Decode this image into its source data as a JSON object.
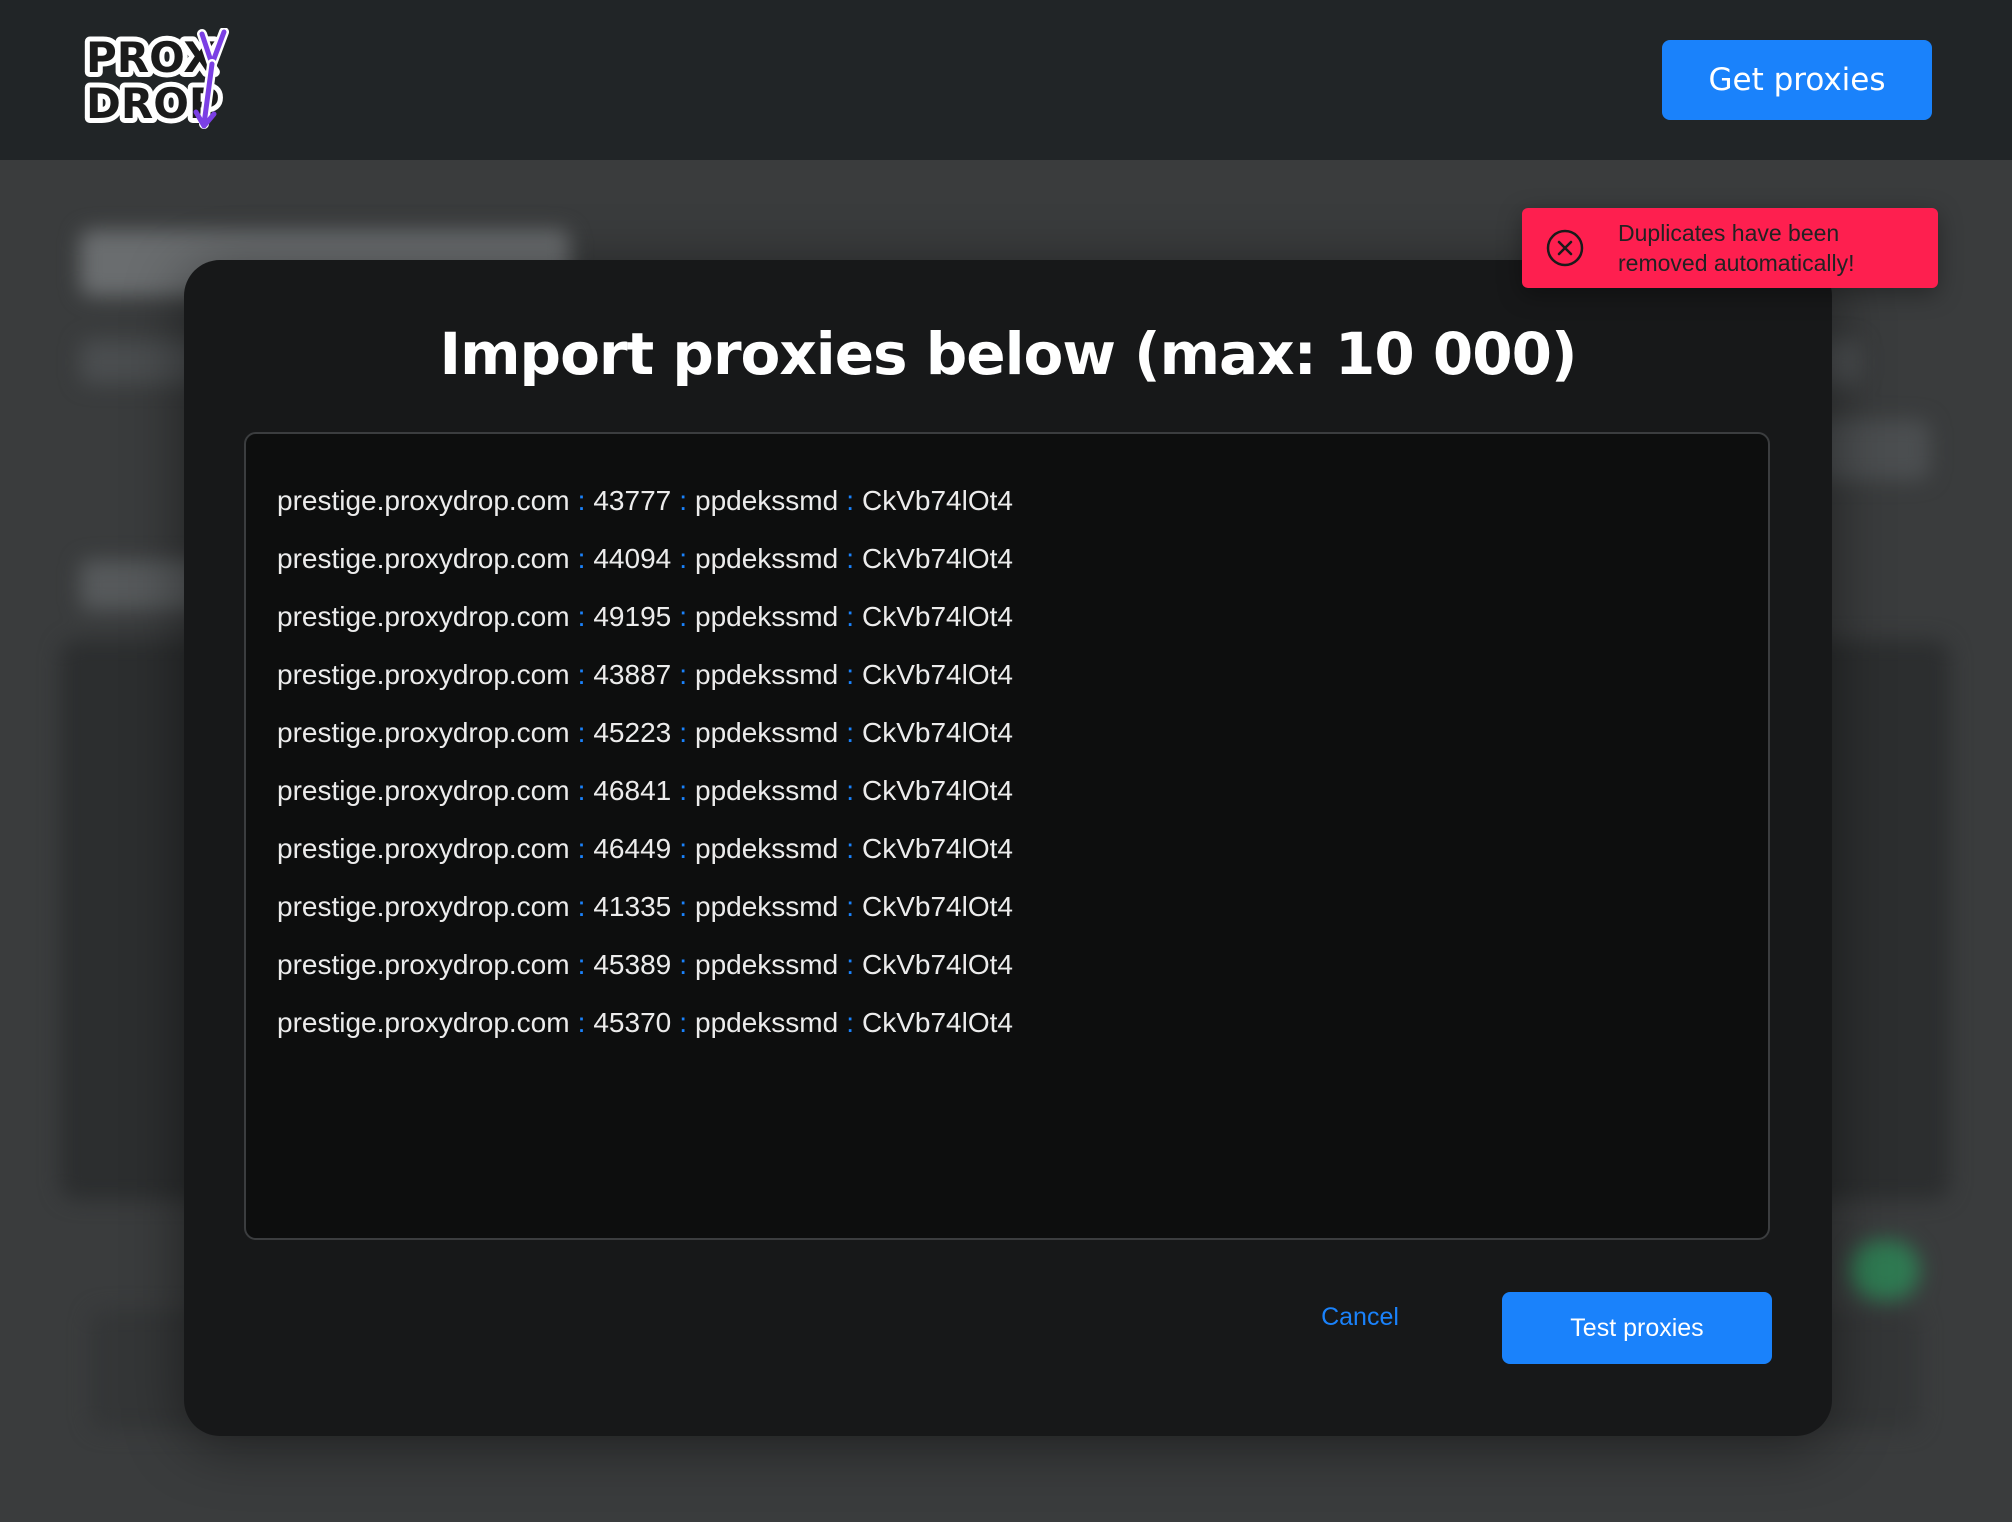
{
  "header": {
    "logo_text": "PROXY DROP",
    "get_proxies_label": "Get proxies"
  },
  "modal": {
    "title": "Import proxies below (max: 10 000)",
    "separator": ":",
    "proxies": [
      {
        "host": "prestige.proxydrop.com",
        "port": "43777",
        "user": "ppdekssmd",
        "pass": "CkVb74lOt4"
      },
      {
        "host": "prestige.proxydrop.com",
        "port": "44094",
        "user": "ppdekssmd",
        "pass": "CkVb74lOt4"
      },
      {
        "host": "prestige.proxydrop.com",
        "port": "49195",
        "user": "ppdekssmd",
        "pass": "CkVb74lOt4"
      },
      {
        "host": "prestige.proxydrop.com",
        "port": "43887",
        "user": "ppdekssmd",
        "pass": "CkVb74lOt4"
      },
      {
        "host": "prestige.proxydrop.com",
        "port": "45223",
        "user": "ppdekssmd",
        "pass": "CkVb74lOt4"
      },
      {
        "host": "prestige.proxydrop.com",
        "port": "46841",
        "user": "ppdekssmd",
        "pass": "CkVb74lOt4"
      },
      {
        "host": "prestige.proxydrop.com",
        "port": "46449",
        "user": "ppdekssmd",
        "pass": "CkVb74lOt4"
      },
      {
        "host": "prestige.proxydrop.com",
        "port": "41335",
        "user": "ppdekssmd",
        "pass": "CkVb74lOt4"
      },
      {
        "host": "prestige.proxydrop.com",
        "port": "45389",
        "user": "ppdekssmd",
        "pass": "CkVb74lOt4"
      },
      {
        "host": "prestige.proxydrop.com",
        "port": "45370",
        "user": "ppdekssmd",
        "pass": "CkVb74lOt4"
      }
    ],
    "cancel_label": "Cancel",
    "test_label": "Test proxies"
  },
  "toast": {
    "icon": "close-circle-icon",
    "message": "Duplicates have been removed automatically!"
  },
  "colors": {
    "accent": "#1a82fb",
    "toast_bg": "#fe1f4f",
    "modal_bg": "#171819",
    "header_bg": "#212527",
    "logo_purple": "#7b3fe4"
  }
}
